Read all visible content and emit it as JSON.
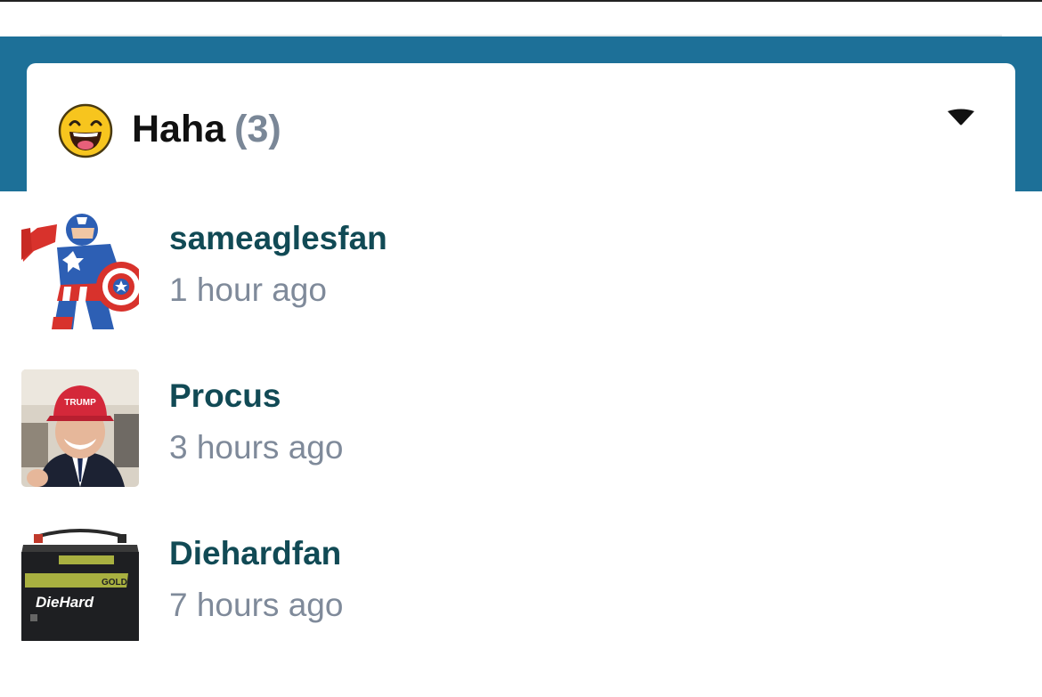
{
  "reaction": {
    "emoji": "laughing-face-icon",
    "label": "Haha",
    "count": "(3)",
    "accent": "#1d7098"
  },
  "users": [
    {
      "name": "sameaglesfan",
      "time": "1 hour ago",
      "avatar": "captain-america-avatar"
    },
    {
      "name": "Procus",
      "time": "3 hours ago",
      "avatar": "trump-hat-portrait-avatar"
    },
    {
      "name": "Diehardfan",
      "time": "7 hours ago",
      "avatar": "diehard-battery-avatar"
    }
  ],
  "avatar_text": {
    "hat": "TRUMP",
    "battery_gold": "GOLD",
    "battery_brand": "DieHard"
  }
}
